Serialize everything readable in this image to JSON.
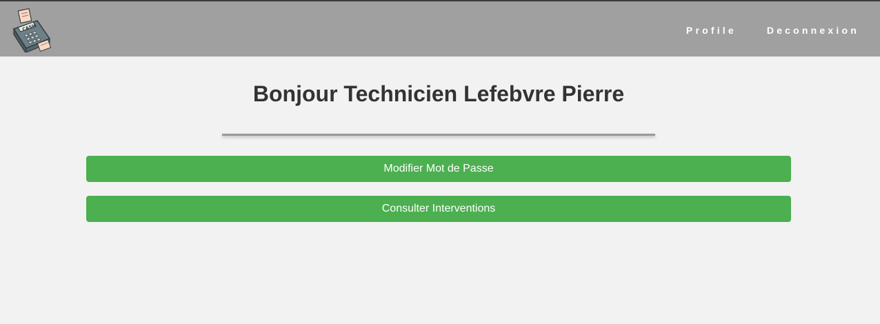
{
  "navbar": {
    "logo_icon": "cash-register-icon",
    "logo_text": "CASH",
    "links": [
      {
        "label": "Profile"
      },
      {
        "label": "Deconnexion"
      }
    ],
    "background": "#a0a0a0"
  },
  "main": {
    "title": "Bonjour Technicien Lefebvre Pierre",
    "buttons": [
      {
        "label": "Modifier Mot de Passe"
      },
      {
        "label": "Consulter Interventions"
      }
    ],
    "accent_color": "#4caf50"
  }
}
